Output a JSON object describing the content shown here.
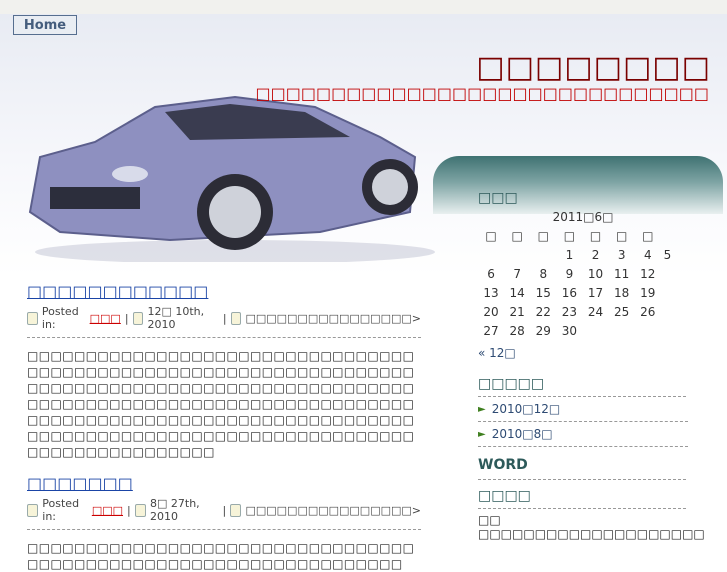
{
  "nav": {
    "home": "Home"
  },
  "header": {
    "title": "□□□□□□□□",
    "description": "□□□□□□□□□□□□□□□□□□□□□□□□□□□□□□"
  },
  "posts": [
    {
      "title": "□□□□□□□□□□□□",
      "posted_in": "Posted in:",
      "author": "□□□",
      "date": "12□ 10th, 2010",
      "comments": "□□□□□□□□□□□□□□□□>",
      "body": "□□□□□□□□□□□□□□□□□□□□□□□□□□□□□□□□□□□□□□□□□□□□□□□□□□□□□□□□□□□□□□□□□□□□□□□□□□□□□□□□□□□□□□□□□□□□□□□□□□□□□□□□□□□□□□□□□□□□□□□□□□□□□□□□□□□□□□□□□□□□□□□□□□□□□□□□□□□□□□□□□□□□□□□□□□□□□□□□□□□□□□□□□□□□□□□□□□□□□□□□□□□□□□□□□□□□□□"
    },
    {
      "title": "□□□□□□□",
      "posted_in": "Posted in:",
      "author": "□□□",
      "date": "8□ 27th, 2010",
      "comments": "□□□□□□□□□□□□□□□□>",
      "body": "□□□□□□□□□□□□□□□□□□□□□□□□□□□□□□□□□□□□□□□□□□□□□□□□□□□□□□□□□□□□□□□□□"
    }
  ],
  "sidebar": {
    "calendar_title": "□□□",
    "month": "2011□6□",
    "weekdays": [
      "□",
      "□",
      "□",
      "□",
      "□",
      "□",
      "□"
    ],
    "weeks": [
      [
        "",
        "",
        "",
        "1",
        "2",
        "3",
        "4",
        "5"
      ],
      [
        "6",
        "7",
        "8",
        "9",
        "10",
        "11",
        "12"
      ],
      [
        "13",
        "14",
        "15",
        "16",
        "17",
        "18",
        "19"
      ],
      [
        "20",
        "21",
        "22",
        "23",
        "24",
        "25",
        "26"
      ],
      [
        "27",
        "28",
        "29",
        "30",
        "",
        "",
        ""
      ]
    ],
    "prev": "« 12□",
    "archive_title": "□□□□□",
    "archives": [
      "2010□12□",
      "2010□8□"
    ],
    "word_title": "WORD",
    "links_title": "□□□□",
    "link_text": "□□",
    "link_desc": "□□□□□□□□□□□□□□□□□□□□"
  },
  "colors": {
    "title": "#7a0000",
    "accent_red": "#c00000",
    "link_blue": "#1b45a6",
    "panel_teal": "#3f7272"
  }
}
